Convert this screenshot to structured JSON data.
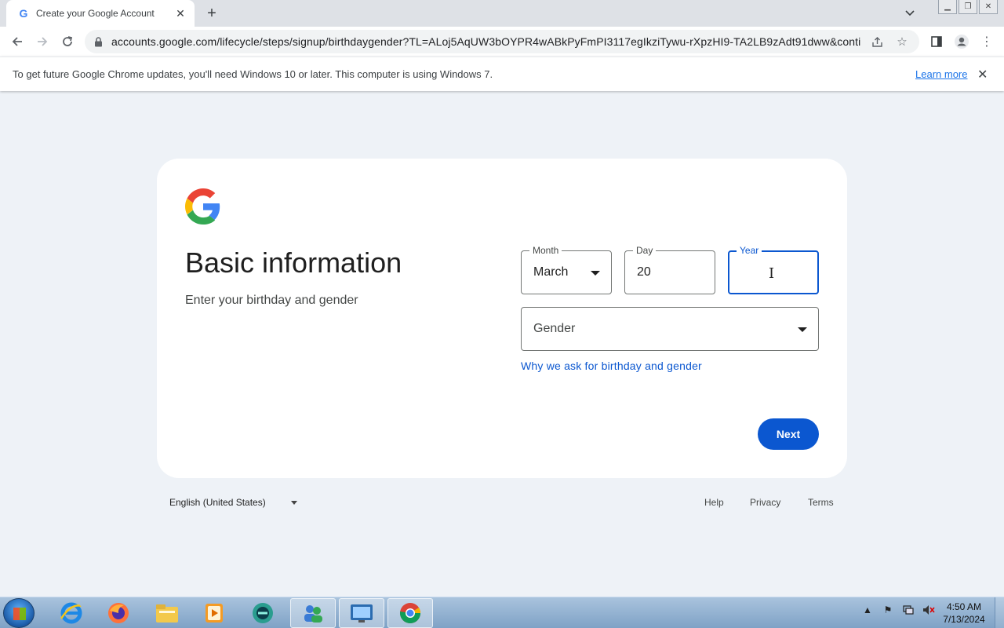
{
  "browser": {
    "tab_title": "Create your Google Account",
    "tab_favicon": "G",
    "url": "accounts.google.com/lifecycle/steps/signup/birthdaygender?TL=ALoj5AqUW3bOYPR4wABkPyFmPI3117egIkziTywu-rXpzHI9-TA2LB9zAdt91dww&continu..."
  },
  "infobar": {
    "message": "To get future Google Chrome updates, you'll need Windows 10 or later. This computer is using Windows 7.",
    "link": "Learn more"
  },
  "page": {
    "title": "Basic information",
    "subtitle": "Enter your birthday and gender",
    "month": {
      "label": "Month",
      "value": "March"
    },
    "day": {
      "label": "Day",
      "value": "20"
    },
    "year": {
      "label": "Year",
      "value": ""
    },
    "gender": {
      "placeholder": "Gender"
    },
    "why_link": "Why we ask for birthday and gender",
    "next_button": "Next"
  },
  "footer": {
    "language": "English (United States)",
    "links": [
      "Help",
      "Privacy",
      "Terms"
    ]
  },
  "taskbar": {
    "time": "4:50 AM",
    "date": "7/13/2024"
  },
  "colors": {
    "accent": "#0b57d0",
    "page_bg": "#eef2f7",
    "link_blue": "#1a73e8"
  }
}
